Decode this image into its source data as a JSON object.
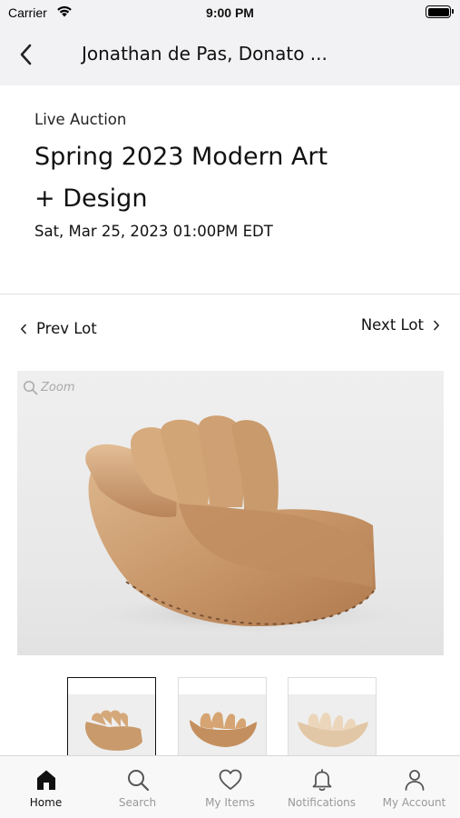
{
  "status_bar": {
    "carrier": "Carrier",
    "time": "9:00 PM"
  },
  "nav": {
    "title": "Jonathan de Pas, Donato ..."
  },
  "auction": {
    "type": "Live Auction",
    "name": "Spring 2023 Modern Art + Design",
    "date": "Sat, Mar 25, 2023 01:00PM EDT"
  },
  "lot_nav": {
    "prev_label": "Prev Lot",
    "next_label": "Next Lot"
  },
  "image": {
    "zoom_label": "Zoom"
  },
  "thumbnails": {
    "selected_index": 0,
    "count": 3
  },
  "tabs": [
    {
      "label": "Home",
      "icon": "home-icon",
      "active": true
    },
    {
      "label": "Search",
      "icon": "search-icon",
      "active": false
    },
    {
      "label": "My Items",
      "icon": "heart-icon",
      "active": false
    },
    {
      "label": "Notifications",
      "icon": "bell-icon",
      "active": false
    },
    {
      "label": "My Account",
      "icon": "person-icon",
      "active": false
    }
  ],
  "colors": {
    "leather": "#c99a6c",
    "leather_dark": "#a87348",
    "active_tab": "#111111",
    "inactive_tab": "#999999"
  }
}
